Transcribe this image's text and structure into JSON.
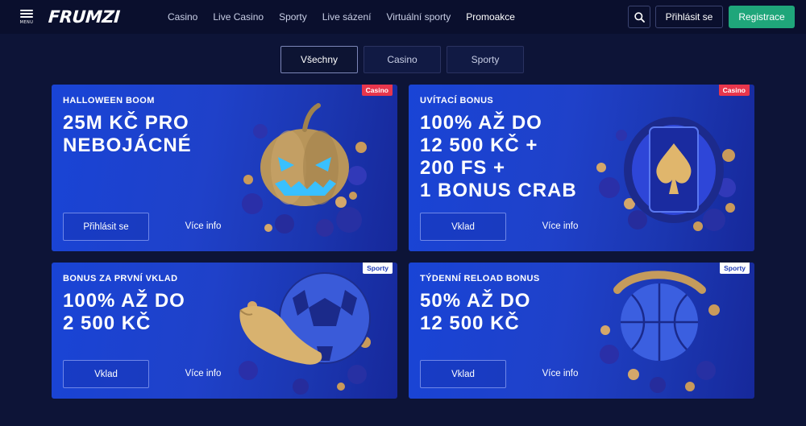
{
  "header": {
    "menu_label": "MENU",
    "logo_text": "FRUMZI",
    "nav": [
      {
        "label": "Casino"
      },
      {
        "label": "Live Casino"
      },
      {
        "label": "Sporty"
      },
      {
        "label": "Live sázení"
      },
      {
        "label": "Virtuální sporty"
      },
      {
        "label": "Promoakce"
      }
    ],
    "search_icon": "search-icon",
    "login_label": "Přihlásit se",
    "register_label": "Registrace"
  },
  "filters": {
    "tabs": [
      {
        "label": "Všechny",
        "active": true
      },
      {
        "label": "Casino",
        "active": false
      },
      {
        "label": "Sporty",
        "active": false
      }
    ]
  },
  "promos": [
    {
      "tag": "Casino",
      "subtitle": "HALLOWEEN BOOM",
      "headline": [
        "25M KČ PRO",
        "NEBOJÁCNÉ"
      ],
      "cta": "Přihlásit se",
      "more": "Více info",
      "art": "pumpkin-illustration"
    },
    {
      "tag": "Casino",
      "subtitle": "UVÍTACÍ BONUS",
      "headline": [
        "100% AŽ DO",
        "12 500 KČ +",
        "200 FS +",
        "1 BONUS CRAB"
      ],
      "cta": "Vklad",
      "more": "Více info",
      "art": "slot-reel-illustration"
    },
    {
      "tag": "Sporty",
      "subtitle": "BONUS ZA PRVNÍ VKLAD",
      "headline": [
        "100% AŽ DO",
        "2 500 KČ"
      ],
      "cta": "Vklad",
      "more": "Více info",
      "art": "football-boot-illustration"
    },
    {
      "tag": "Sporty",
      "subtitle": "TÝDENNÍ RELOAD BONUS",
      "headline": [
        "50% AŽ DO",
        "12 500 KČ"
      ],
      "cta": "Vklad",
      "more": "Více info",
      "art": "basketball-illustration"
    }
  ],
  "colors": {
    "background": "#0d1437",
    "header": "#0a0f2d",
    "register": "#1fa67a",
    "casino_tag": "#e8364c",
    "card_blue": "#1f41c9"
  }
}
